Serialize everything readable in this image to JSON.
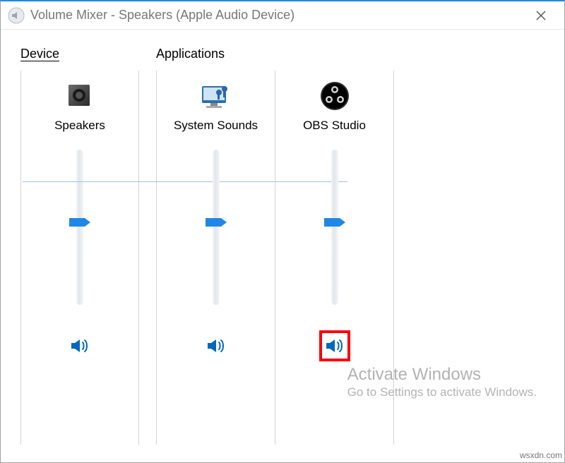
{
  "window": {
    "title": "Volume Mixer - Speakers (Apple Audio Device)"
  },
  "groups": {
    "device_label": "Device",
    "apps_label": "Applications"
  },
  "device": {
    "name": "Speakers",
    "icon": "speaker-icon",
    "volume_percent": 53,
    "muted": false
  },
  "applications": [
    {
      "name": "System Sounds",
      "icon": "system-sounds-icon",
      "volume_percent": 53,
      "muted": false
    },
    {
      "name": "OBS Studio",
      "icon": "obs-icon",
      "volume_percent": 53,
      "muted": false,
      "highlighted": true
    }
  ],
  "watermark": {
    "line1": "Activate Windows",
    "line2": "Go to Settings to activate Windows."
  },
  "footer_text": "wsxdn.com",
  "colors": {
    "accent": "#0067c0",
    "highlight": "#ff0000"
  }
}
